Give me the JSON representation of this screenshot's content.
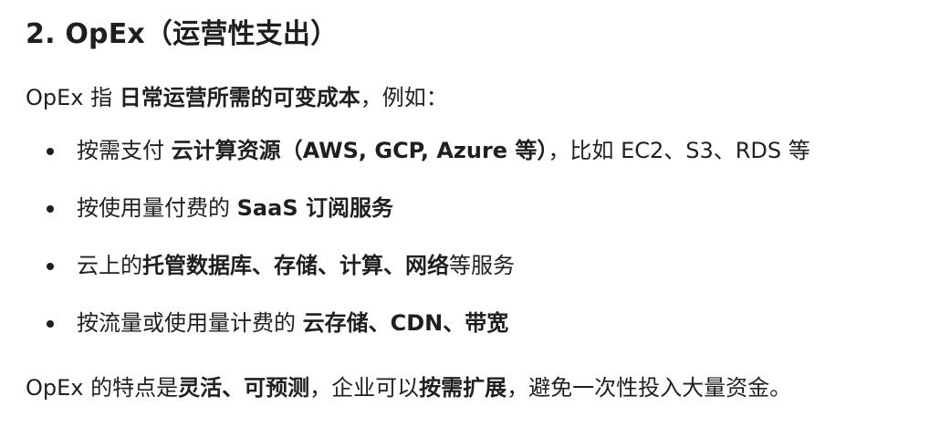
{
  "heading": "2. OpEx（运营性支出）",
  "intro": {
    "prefix": "OpEx 指 ",
    "bold": "日常运营所需的可变成本",
    "suffix": "，例如："
  },
  "bullets": [
    {
      "before": "按需支付 ",
      "bold": "云计算资源（AWS, GCP, Azure 等）",
      "after": "，比如 EC2、S3、RDS 等"
    },
    {
      "before": "按使用量付费的 ",
      "bold": "SaaS 订阅服务",
      "after": ""
    },
    {
      "before": "云上的",
      "bold": "托管数据库、存储、计算、网络",
      "after": "等服务"
    },
    {
      "before": "按流量或使用量计费的 ",
      "bold": "云存储、CDN、带宽",
      "after": ""
    }
  ],
  "summary": {
    "part1": "OpEx 的特点是",
    "bold1": "灵活、可预测",
    "part2": "，企业可以",
    "bold2": "按需扩展",
    "part3": "，避免一次性投入大量资金。"
  }
}
